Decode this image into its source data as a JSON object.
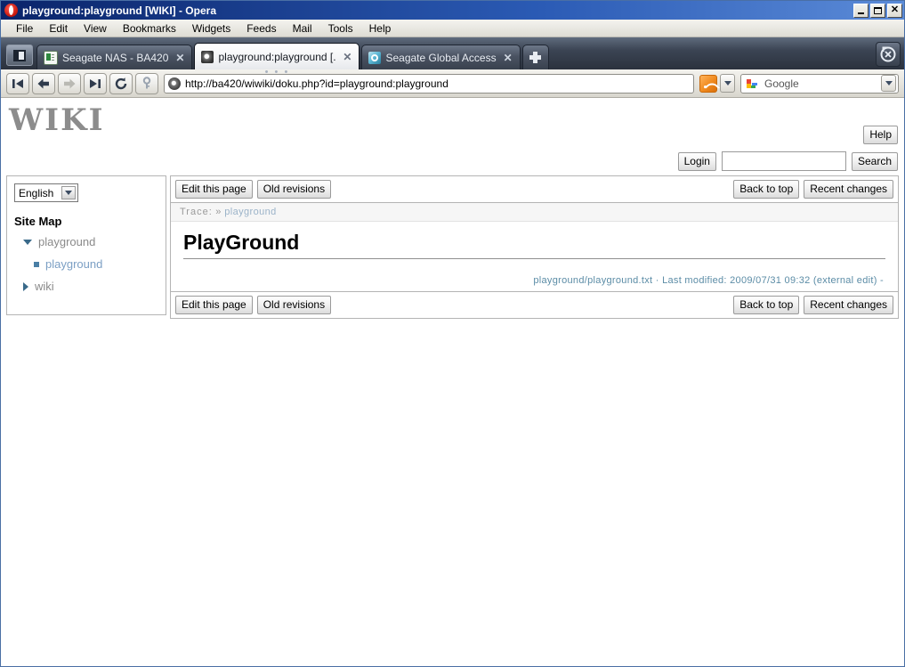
{
  "window": {
    "title": "playground:playground [WIKI] - Opera",
    "app_icon": "opera-icon",
    "minimize_label": "_",
    "maximize_label": "",
    "close_label": "✕"
  },
  "menubar": {
    "items": [
      {
        "label": "File"
      },
      {
        "label": "Edit"
      },
      {
        "label": "View"
      },
      {
        "label": "Bookmarks"
      },
      {
        "label": "Widgets"
      },
      {
        "label": "Feeds"
      },
      {
        "label": "Mail"
      },
      {
        "label": "Tools"
      },
      {
        "label": "Help"
      }
    ]
  },
  "tabbar": {
    "panel_toggle_name": "panel-toggle-icon",
    "tabs": [
      {
        "label": "Seagate NAS - BA420",
        "favicon": "document-icon",
        "active": false,
        "close_label": "✕"
      },
      {
        "label": "playground:playground [...",
        "favicon": "opera-icon",
        "active": true,
        "close_label": "✕"
      },
      {
        "label": "Seagate Global Access",
        "favicon": "globe-icon",
        "active": false,
        "close_label": "✕"
      }
    ],
    "new_tab_label": "+",
    "trash_name": "undo-close-tab-icon",
    "active_dots": "• • •"
  },
  "addressbar": {
    "buttons": [
      {
        "name": "go-to-start-button",
        "icon": "first-page-icon"
      },
      {
        "name": "back-button",
        "icon": "arrow-left-icon"
      },
      {
        "name": "forward-button",
        "icon": "arrow-right-icon"
      },
      {
        "name": "go-to-end-button",
        "icon": "last-page-icon"
      },
      {
        "name": "reload-button",
        "icon": "reload-icon"
      },
      {
        "name": "security-button",
        "icon": "key-icon"
      }
    ],
    "url": "http://ba420/wiwiki/doku.php?id=playground:playground",
    "url_icon": "opera-icon",
    "rss_name": "rss-icon",
    "rss_dropdown_name": "chevron-down-icon",
    "search_engine": "Google",
    "search_icon": "google-icon",
    "search_dropdown_name": "chevron-down-icon"
  },
  "wiki": {
    "logo": "WIKI",
    "help_label": "Help",
    "login_label": "Login",
    "search_value": "",
    "search_placeholder": "",
    "search_button_label": "Search",
    "sidebar": {
      "language": "English",
      "language_options": [
        "English"
      ],
      "sitemap_title": "Site Map",
      "tree": [
        {
          "label": "playground",
          "expanded": true,
          "marker": "triangle-down-icon",
          "children": [
            {
              "label": "playground",
              "marker": "square-bullet-icon",
              "current": true
            }
          ]
        },
        {
          "label": "wiki",
          "expanded": false,
          "marker": "triangle-right-icon",
          "children": []
        }
      ]
    },
    "toolbar": {
      "edit_label": "Edit this page",
      "revisions_label": "Old revisions",
      "back_to_top_label": "Back to top",
      "recent_changes_label": "Recent changes"
    },
    "trace": {
      "label": "Trace:",
      "separator": "»",
      "items": [
        {
          "label": "playground"
        }
      ]
    },
    "page_title": "PlayGround",
    "docinfo": "playground/playground.txt · Last modified: 2009/07/31 09:32 (external edit) -"
  }
}
